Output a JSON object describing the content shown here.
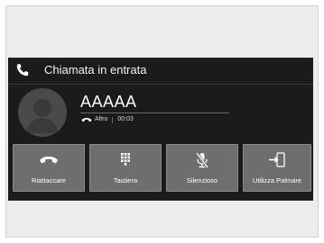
{
  "header": {
    "title": "Chiamata in entrata"
  },
  "caller": {
    "name": "AAAAA",
    "line": "Altro",
    "duration": "00:03"
  },
  "buttons": {
    "hangup": "Riattaccare",
    "keypad": "Tastiera",
    "mute": "Silenzioso",
    "handset": "Utilizza Palmare"
  },
  "colors": {
    "screen_bg": "#1b1b1b",
    "button_bg": "#6e6e6e",
    "text": "#ffffff"
  },
  "icons": {
    "header": "phone-icon",
    "line": "phone-handset-icon",
    "hangup": "hang-up-icon",
    "keypad": "keypad-icon",
    "mute": "microphone-muted-icon",
    "handset": "transfer-to-phone-icon"
  }
}
